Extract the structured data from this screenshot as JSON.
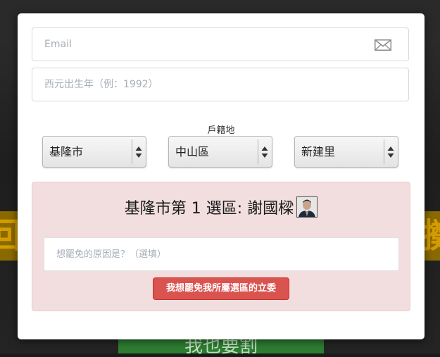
{
  "form": {
    "email_placeholder": "Email",
    "birth_year_placeholder": "西元出生年（例：1992）",
    "household_label": "戶籍地",
    "city_selected": "基隆市",
    "district_selected": "中山區",
    "village_selected": "新建里"
  },
  "result": {
    "title": "基隆市第 1 選區: 謝國樑",
    "reason_placeholder": "想罷免的原因是？（選填）",
    "submit_label": "我想罷免我所屬選區的立委"
  },
  "background": {
    "left_glyph": "回",
    "right_glyph": "擲",
    "green_button_text": "我也要割"
  },
  "colors": {
    "danger": "#d9534f",
    "panel_bg": "#f2dede",
    "placeholder": "#a7aeb8"
  },
  "icons": {
    "email": "envelope-icon",
    "select_arrows": "up-down-arrows-icon"
  }
}
